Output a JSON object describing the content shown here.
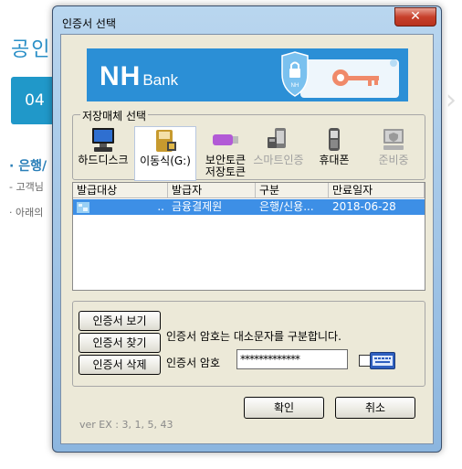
{
  "background": {
    "title": "공인",
    "step": "04",
    "heading": "· 은행/",
    "line1": "- 고객님",
    "line2": "· 아래의"
  },
  "dialog": {
    "title": "인증서 선택",
    "close_symbol": "✕",
    "banner": {
      "logo_main": "NH",
      "logo_sub": "Bank"
    },
    "media_group_label": "저장매체 선택",
    "media": [
      {
        "label": "하드디스크",
        "icon": "monitor-icon",
        "enabled": true,
        "selected": false
      },
      {
        "label": "이동식(G:)",
        "icon": "removable-drive-icon",
        "enabled": true,
        "selected": true
      },
      {
        "label": "보안토큰\n저장토큰",
        "icon": "usb-token-icon",
        "enabled": true,
        "selected": false
      },
      {
        "label": "스마트인증",
        "icon": "smart-auth-icon",
        "enabled": false,
        "selected": false
      },
      {
        "label": "휴대폰",
        "icon": "mobile-phone-icon",
        "enabled": true,
        "selected": false
      },
      {
        "label": "준비중",
        "icon": "pending-icon",
        "enabled": false,
        "selected": false
      }
    ],
    "cert_table": {
      "columns": [
        "발급대상",
        "발급자",
        "구분",
        "만료일자"
      ],
      "rows": [
        {
          "subject": "..",
          "issuer": "금융결제원",
          "type": "은행/신용...",
          "expiry": "2018-06-28"
        }
      ]
    },
    "buttons": {
      "view": "인증서 보기",
      "find": "인증서 찾기",
      "delete": "인증서 삭제",
      "ok": "확인",
      "cancel": "취소"
    },
    "case_hint": "인증서 암호는 대소문자를 구분합니다.",
    "password_label": "인증서 암호",
    "password_value": "*************",
    "version": "ver EX : 3, 1, 5, 43"
  }
}
